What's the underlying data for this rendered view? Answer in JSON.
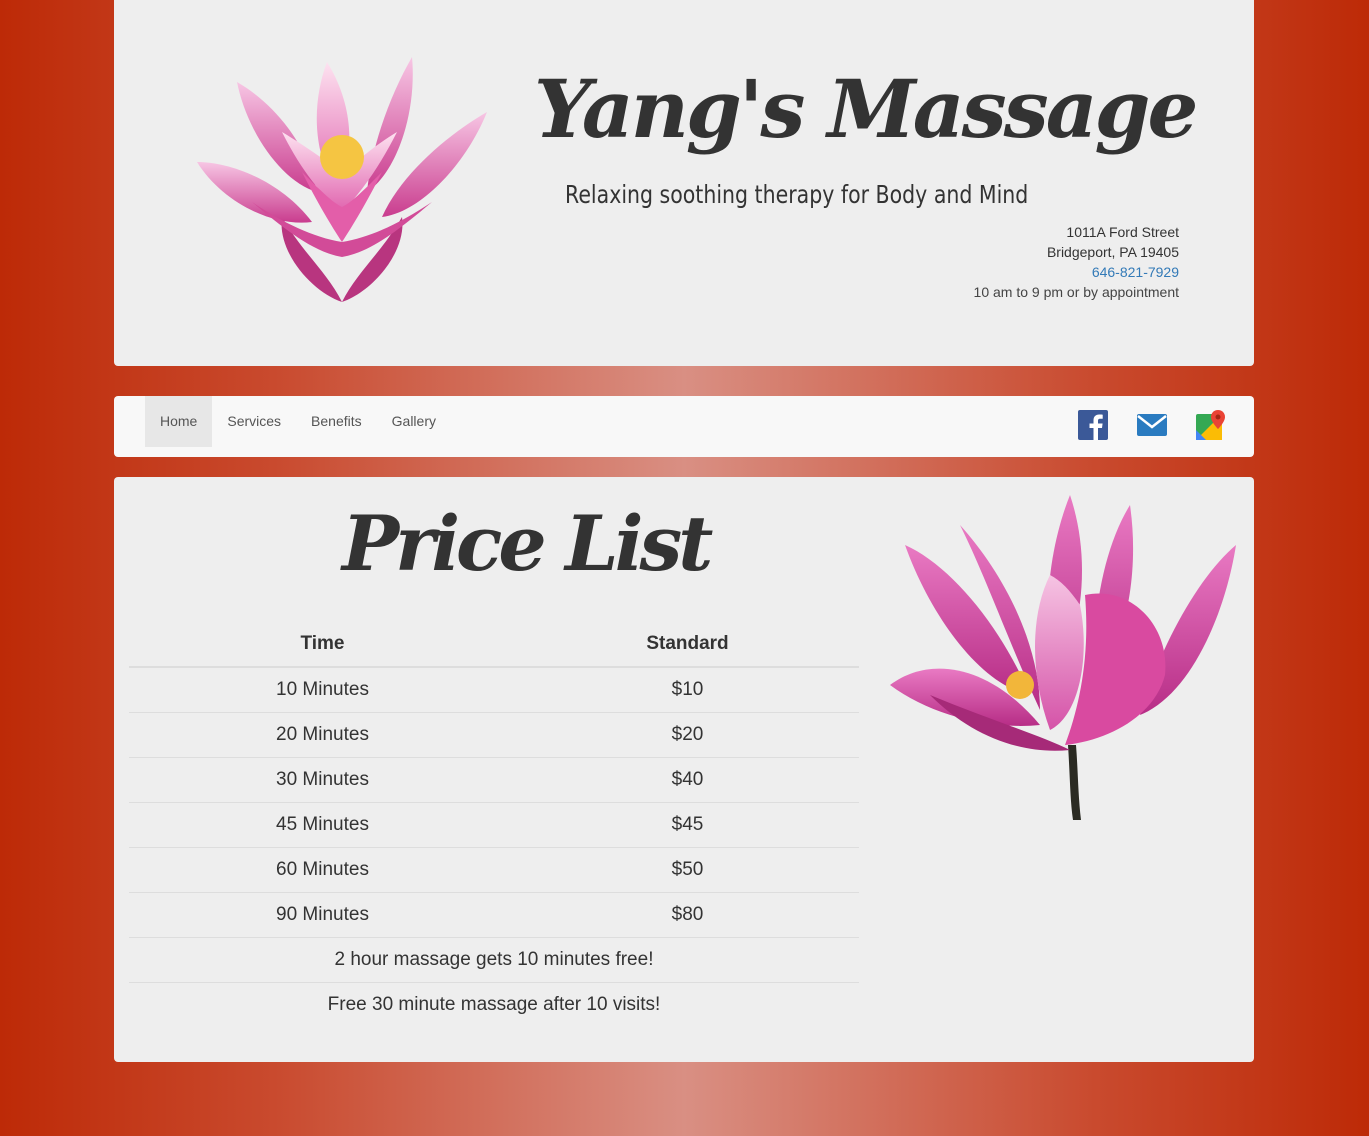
{
  "header": {
    "title": "Yang's Massage",
    "tagline": "Relaxing soothing therapy for Body and Mind",
    "address_line1": "1011A Ford Street",
    "address_line2": "Bridgeport, PA 19405",
    "phone": "646-821-7929",
    "hours": "10 am to 9 pm or by appointment"
  },
  "nav": {
    "items": [
      {
        "label": "Home"
      },
      {
        "label": "Services"
      },
      {
        "label": "Benefits"
      },
      {
        "label": "Gallery"
      }
    ],
    "social_icons": [
      "facebook-icon",
      "email-icon",
      "google-maps-icon"
    ]
  },
  "main": {
    "title": "Price List",
    "columns": [
      "Time",
      "Standard"
    ],
    "rows": [
      {
        "time": "10 Minutes",
        "price": "$10"
      },
      {
        "time": "20 Minutes",
        "price": "$20"
      },
      {
        "time": "30 Minutes",
        "price": "$40"
      },
      {
        "time": "45 Minutes",
        "price": "$45"
      },
      {
        "time": "60 Minutes",
        "price": "$50"
      },
      {
        "time": "90 Minutes",
        "price": "$80"
      }
    ],
    "notes": [
      "2 hour massage gets 10 minutes free!",
      "Free 30 minute massage after 10 visits!"
    ]
  },
  "colors": {
    "background_red": "#bd2a07",
    "panel": "#eeeeee",
    "link_blue": "#337ab7",
    "lotus_pink": "#d94aa0"
  }
}
